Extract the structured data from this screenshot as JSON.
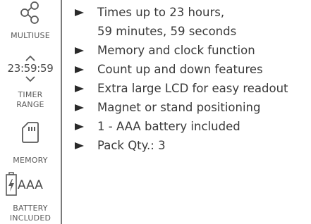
{
  "sidebar": {
    "items": [
      {
        "icon": "share-nodes-icon",
        "label": "MULTIUSE"
      },
      {
        "icon": "timer-range-icon",
        "readout": "23:59:59",
        "label_line1": "TIMER",
        "label_line2": "RANGE"
      },
      {
        "icon": "memory-card-icon",
        "label": "MEMORY"
      },
      {
        "icon": "battery-icon",
        "readout": "AAA",
        "label_line1": "BATTERY",
        "label_line2": "INCLUDED"
      }
    ]
  },
  "features": [
    {
      "line1": "Times up to 23 hours,",
      "line2": "59 minutes, 59 seconds"
    },
    {
      "line1": "Memory and clock function"
    },
    {
      "line1": "Count up and down features"
    },
    {
      "line1": "Extra large LCD for easy readout"
    },
    {
      "line1": "Magnet or stand positioning"
    },
    {
      "line1": "1 - AAA battery included"
    },
    {
      "line1": "Pack Qty.: 3"
    }
  ],
  "colors": {
    "text": "#3a3a3a",
    "icon": "#5a5a5a",
    "divider": "#7a7a7a"
  }
}
